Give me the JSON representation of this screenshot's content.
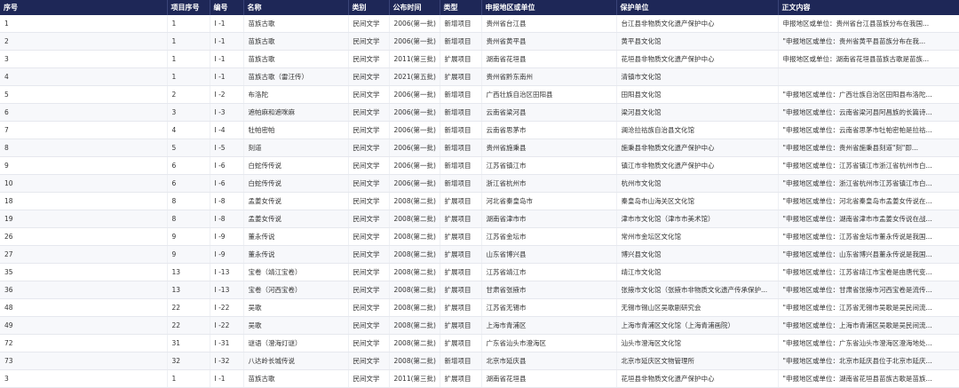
{
  "headers": [
    "序号",
    "项目序号",
    "编号",
    "名称",
    "类别",
    "公布时间",
    "类型",
    "申报地区或单位",
    "保护单位",
    "正文内容"
  ],
  "rows": [
    [
      "1",
      "1",
      "I -1",
      "苗族古歌",
      "民间文学",
      "2006(第一批)",
      "新增项目",
      "贵州省台江县",
      "台江县非物质文化遗产保护中心",
      "申报地区或单位：贵州省台江县苗族分布在我国..."
    ],
    [
      "2",
      "1",
      "I -1",
      "苗族古歌",
      "民间文学",
      "2006(第一批)",
      "新增项目",
      "贵州省黄平县",
      "黄平县文化馆",
      "\"申报地区或单位：贵州省黄平县苗族分布在我..."
    ],
    [
      "3",
      "1",
      "I -1",
      "苗族古歌",
      "民间文学",
      "2011(第三批)",
      "扩展项目",
      "湖南省花垣县",
      "花垣县非物质文化遗产保护中心",
      "申报地区或单位：湖南省花垣县苗族古歌是苗族..."
    ],
    [
      "4",
      "1",
      "I -1",
      "苗族古歌（雷汪传）",
      "民间文学",
      "2021(第五批)",
      "扩展项目",
      "贵州省黔东南州",
      "清镇市文化馆",
      ""
    ],
    [
      "5",
      "2",
      "I -2",
      "布洛陀",
      "民间文学",
      "2006(第一批)",
      "新增项目",
      "广西壮族自治区田阳县",
      "田阳县文化馆",
      "\"申报地区或单位：广西壮族自治区田阳县布洛陀..."
    ],
    [
      "6",
      "3",
      "I -3",
      "遮帕麻和遮咪麻",
      "民间文学",
      "2006(第一批)",
      "新增项目",
      "云南省梁河县",
      "梁河县文化馆",
      "\"申报地区或单位：云南省梁河县阿昌族的长篇诗..."
    ],
    [
      "7",
      "4",
      "I -4",
      "牡帕密帕",
      "民间文学",
      "2006(第一批)",
      "新增项目",
      "云南省思茅市",
      "澜沧拉祜族自治县文化馆",
      "\"申报地区或单位：云南省思茅市牡帕密帕是拉祜..."
    ],
    [
      "8",
      "5",
      "I -5",
      "刻道",
      "民间文学",
      "2006(第一批)",
      "新增项目",
      "贵州省施秉县",
      "施秉县非物质文化遗产保护中心",
      "\"申报地区或单位：贵州省施秉县刻道\"刻\"即..."
    ],
    [
      "9",
      "6",
      "I -6",
      "白蛇传传说",
      "民间文学",
      "2006(第一批)",
      "新增项目",
      "江苏省镇江市",
      "镇江市非物质文化遗产保护中心",
      "\"申报地区或单位：江苏省镇江市浙江省杭州市白..."
    ],
    [
      "10",
      "6",
      "I -6",
      "白蛇传传说",
      "民间文学",
      "2006(第一批)",
      "新增项目",
      "浙江省杭州市",
      "杭州市文化馆",
      "\"申报地区或单位：浙江省杭州市江苏省镇江市白..."
    ],
    [
      "18",
      "8",
      "I -8",
      "孟姜女传说",
      "民间文学",
      "2008(第二批)",
      "扩展项目",
      "河北省秦皇岛市",
      "秦皇岛市山海关区文化馆",
      "\"申报地区或单位：河北省秦皇岛市孟姜女传说在..."
    ],
    [
      "19",
      "8",
      "I -8",
      "孟姜女传说",
      "民间文学",
      "2008(第二批)",
      "扩展项目",
      "湖南省津市市",
      "津市市文化馆（津市市美术馆）",
      "\"申报地区或单位：湖南省津市市孟姜女传说在战..."
    ],
    [
      "26",
      "9",
      "I -9",
      "董永传说",
      "民间文学",
      "2008(第二批)",
      "扩展项目",
      "江苏省金坛市",
      "常州市金坛区文化馆",
      "\"申报地区或单位：江苏省金坛市董永传说是我国..."
    ],
    [
      "27",
      "9",
      "I -9",
      "董永传说",
      "民间文学",
      "2008(第二批)",
      "扩展项目",
      "山东省博兴县",
      "博兴县文化馆",
      "\"申报地区或单位：山东省博兴县董永传说是我国..."
    ],
    [
      "35",
      "13",
      "I -13",
      "宝卷（靖江宝卷）",
      "民间文学",
      "2008(第二批)",
      "扩展项目",
      "江苏省靖江市",
      "靖江市文化馆",
      "\"申报地区或单位：江苏省靖江市宝卷是由唐代变..."
    ],
    [
      "36",
      "13",
      "I -13",
      "宝卷（河西宝卷）",
      "民间文学",
      "2008(第二批)",
      "扩展项目",
      "甘肃省张掖市",
      "张掖市文化馆（张掖市非物质文化遗产传承保护...",
      "\"申报地区或单位：甘肃省张掖市河西宝卷是流传..."
    ],
    [
      "48",
      "22",
      "I -22",
      "吴歌",
      "民间文学",
      "2008(第二批)",
      "扩展项目",
      "江苏省无锡市",
      "无锡市锡山区吴歌剧研究会",
      "\"申报地区或单位：江苏省无锡市吴歌是吴民间流..."
    ],
    [
      "49",
      "22",
      "I -22",
      "吴歌",
      "民间文学",
      "2008(第二批)",
      "扩展项目",
      "上海市青浦区",
      "上海市青浦区文化馆（上海青浦画院）",
      "\"申报地区或单位：上海市青浦区吴歌是吴民间流..."
    ],
    [
      "72",
      "31",
      "I -31",
      "谜语（澄海灯谜）",
      "民间文学",
      "2008(第二批)",
      "扩展项目",
      "广东省汕头市澄海区",
      "汕头市澄海区文化馆",
      "\"申报地区或单位：广东省汕头市澄海区澄海地处..."
    ],
    [
      "73",
      "32",
      "I -32",
      "八达岭长城传说",
      "民间文学",
      "2008(第二批)",
      "新增项目",
      "北京市延庆县",
      "北京市延庆区文物管理所",
      "\"申报地区或单位：北京市延庆县位于北京市延庆..."
    ],
    [
      "3",
      "1",
      "I -1",
      "苗族古歌",
      "民间文学",
      "2011(第三批)",
      "扩展项目",
      "湖南省花垣县",
      "花垣县非物质文化遗产保护中心",
      "\"申报地区或单位：湖南省花垣县苗族古歌是苗族..."
    ]
  ]
}
